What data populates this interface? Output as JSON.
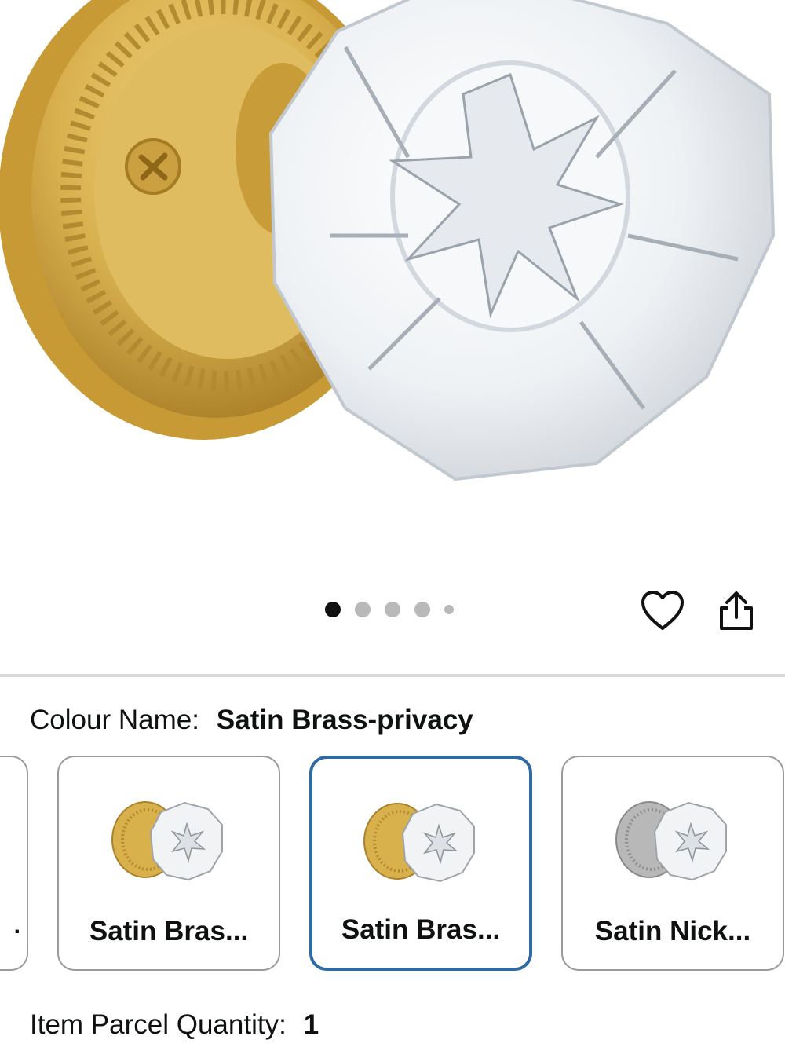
{
  "product": {
    "image_alt": "Satin brass door knob with faceted crystal glass handle",
    "image_count": 5,
    "active_image": 1
  },
  "actions": {
    "wishlist_icon": "heart-icon",
    "share_icon": "share-icon"
  },
  "variation": {
    "label": "Colour Name:",
    "selected_value": "Satin Brass-privacy",
    "options": [
      {
        "label": "",
        "thumb": "brass-knob",
        "selected": false
      },
      {
        "label": "Satin Bras...",
        "thumb": "brass-knob",
        "selected": false
      },
      {
        "label": "Satin Bras...",
        "thumb": "brass-knob",
        "selected": true
      },
      {
        "label": "Satin Nick...",
        "thumb": "nickel-knob",
        "selected": false
      }
    ]
  },
  "quantity": {
    "label": "Item Parcel Quantity:",
    "value": "1"
  },
  "colors": {
    "brass": "#d8b04c",
    "nickel": "#b8b8b8",
    "selected_border": "#2f6aa3",
    "swatch_border": "#9a9a9a"
  }
}
